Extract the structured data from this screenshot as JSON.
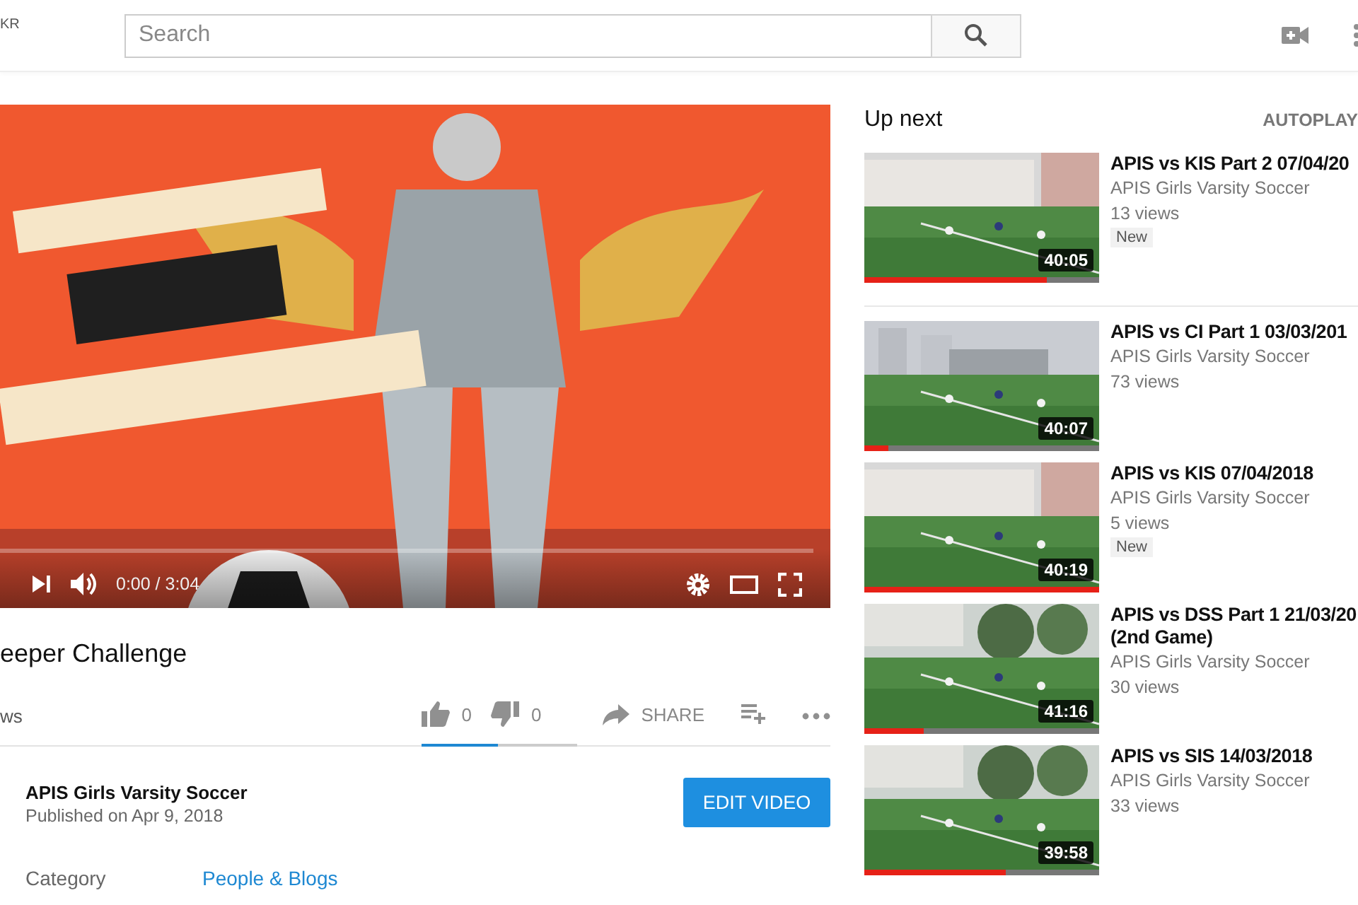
{
  "header": {
    "logo_fragment": "KR",
    "search": {
      "placeholder": "Search"
    }
  },
  "player": {
    "time": "0:00 / 3:04"
  },
  "video": {
    "title": "eeper Challenge",
    "views": "ws",
    "likes": "0",
    "dislikes": "0",
    "share": "SHARE",
    "sentiment": {
      "level": 0.49
    }
  },
  "channel": {
    "name": "APIS Girls Varsity Soccer",
    "published": "Published on Apr 9, 2018",
    "edit_button": "EDIT VIDEO"
  },
  "details": [
    {
      "label": "Category",
      "value": "People & Blogs"
    }
  ],
  "sidebar": {
    "heading": "Up next",
    "autoplay": "AUTOPLAY",
    "items": [
      {
        "title": "APIS vs KIS Part 2 07/04/20",
        "channel": "APIS Girls Varsity Soccer",
        "views": "13 views",
        "badge": "New",
        "duration": "40:05",
        "level": 0.78
      },
      {
        "title": "APIS vs CI Part 1 03/03/201",
        "channel": "APIS Girls Varsity Soccer",
        "views": "73 views",
        "duration": "40:07",
        "level": 0.1
      },
      {
        "title": "APIS vs KIS 07/04/2018",
        "channel": "APIS Girls Varsity Soccer",
        "views": "5 views",
        "badge": "New",
        "duration": "40:19",
        "level": 1
      },
      {
        "title": "APIS vs DSS Part 1 21/03/20 (2nd Game)",
        "channel": "APIS Girls Varsity Soccer",
        "views": "30 views",
        "duration": "41:16",
        "level": 0.25
      },
      {
        "title": "APIS vs SIS 14/03/2018",
        "channel": "APIS Girls Varsity Soccer",
        "views": "33 views",
        "duration": "39:58",
        "level": 0.6
      }
    ]
  }
}
